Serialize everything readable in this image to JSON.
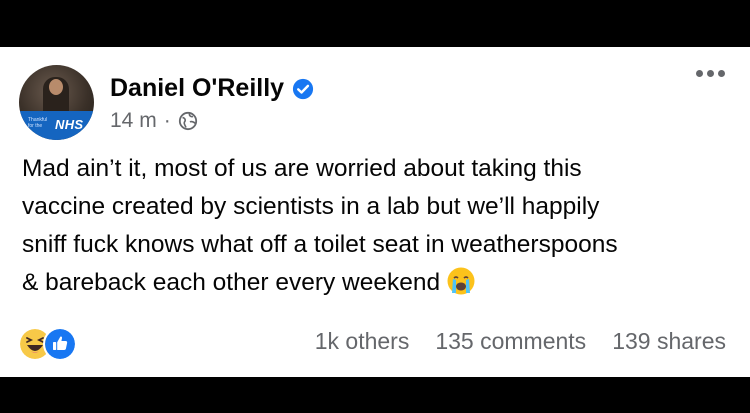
{
  "author": {
    "name": "Daniel O'Reilly",
    "verified": true,
    "frame_text": "NHS",
    "frame_small_text": "Thankful for the"
  },
  "meta": {
    "time": "14 m",
    "separator": "·",
    "audience_icon": "globe-icon"
  },
  "post": {
    "lines": [
      "Mad ain’t it, most of us are worried about taking this",
      "vaccine created by scientists in a lab but we’ll happily",
      "sniff fuck knows what off a toilet seat in weatherspoons",
      "& bareback each other every weekend"
    ],
    "trailing_emoji": "loudly-crying-face-icon"
  },
  "footer": {
    "reaction_icons": [
      "haha-reaction-icon",
      "like-reaction-icon"
    ],
    "reactions_text": "1k others",
    "comments_text": "135 comments",
    "shares_text": "139 shares"
  },
  "colors": {
    "accent": "#1877f2",
    "muted": "#65676b",
    "text": "#050505",
    "haha_yellow": "#f7c948"
  }
}
